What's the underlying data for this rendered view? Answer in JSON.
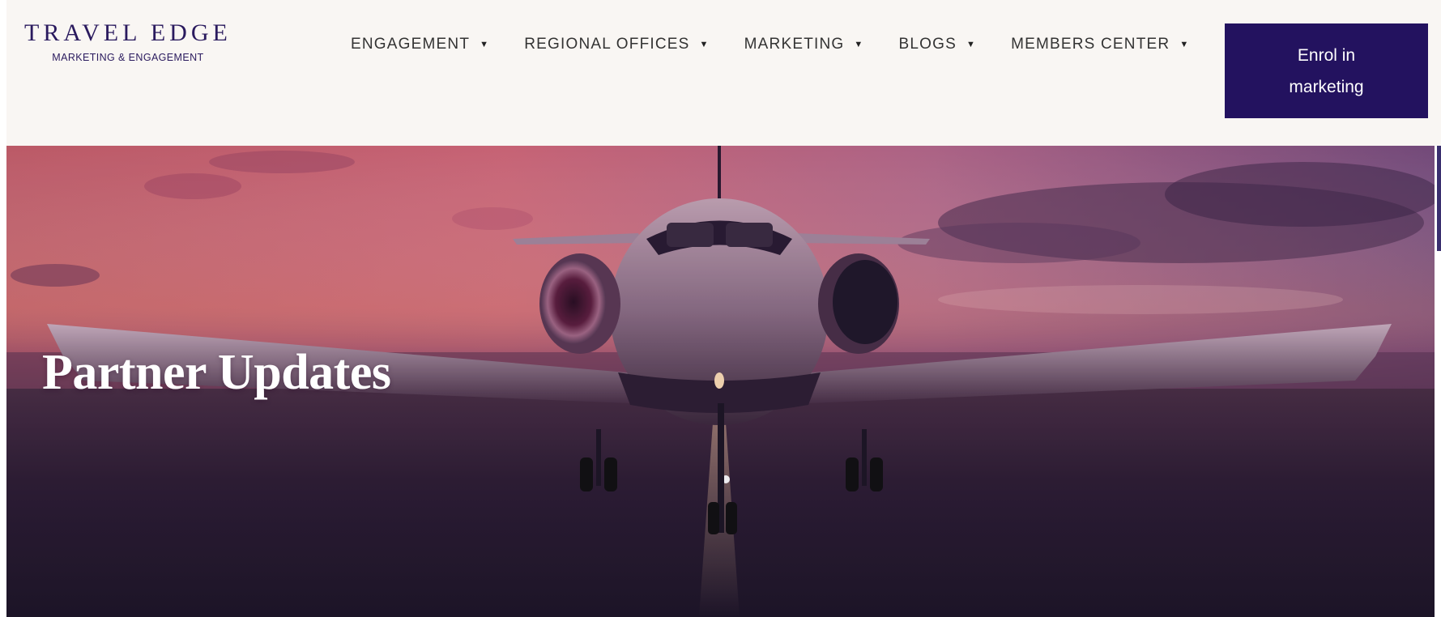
{
  "header": {
    "logo": {
      "title": "TRAVEL EDGE",
      "subtitle": "MARKETING & ENGAGEMENT"
    },
    "nav": [
      {
        "label": "ENGAGEMENT",
        "icon": "caret-down-icon"
      },
      {
        "label": "REGIONAL OFFICES",
        "icon": "caret-down-icon"
      },
      {
        "label": "MARKETING",
        "icon": "caret-down-icon"
      },
      {
        "label": "BLOGS",
        "icon": "caret-down-icon"
      },
      {
        "label": "MEMBERS CENTER",
        "icon": "caret-down-icon"
      }
    ],
    "cta": {
      "label": "Enrol in marketing"
    }
  },
  "hero": {
    "title": "Partner Updates",
    "image": "private-jet-on-runway-at-sunset"
  },
  "colors": {
    "header_bg": "#f9f6f3",
    "brand_dark": "#23125f",
    "logo_text": "#2a1a5e",
    "nav_text": "#333333",
    "hero_title": "#ffffff"
  }
}
